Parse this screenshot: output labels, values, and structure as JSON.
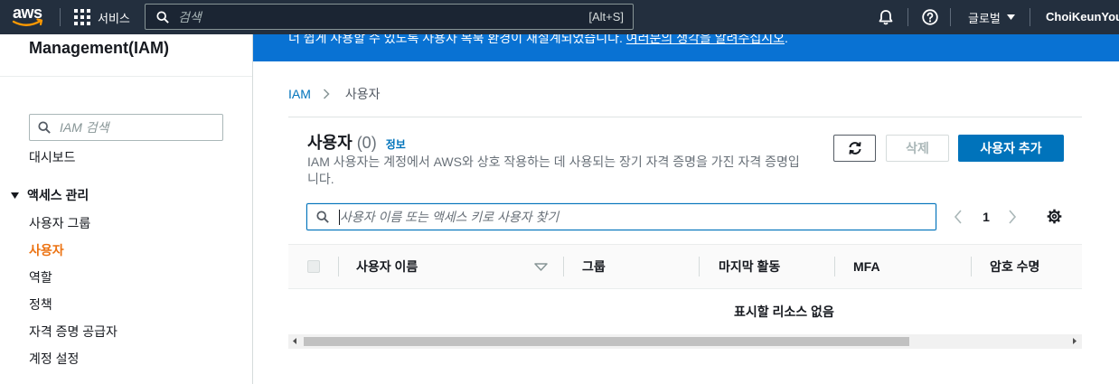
{
  "nav": {
    "logo_text": "aws",
    "services_label": "서비스",
    "search": {
      "placeholder": "검색",
      "value": "",
      "shortcut": "[Alt+S]"
    },
    "region_label": "글로벌",
    "user_label": "ChoiKeunYoung"
  },
  "sidebar": {
    "title": "Management(IAM)",
    "search": {
      "placeholder": "IAM 검색",
      "value": ""
    },
    "dashboard_label": "대시보드",
    "section": {
      "label": "액세스 관리",
      "expanded": true
    },
    "items": [
      {
        "label": "사용자 그룹",
        "active": false
      },
      {
        "label": "사용자",
        "active": true
      },
      {
        "label": "역할",
        "active": false
      },
      {
        "label": "정책",
        "active": false
      },
      {
        "label": "자격 증명 공급자",
        "active": false
      },
      {
        "label": "계정 설정",
        "active": false
      }
    ]
  },
  "banner": {
    "text": "너 쉽게 사용할 수 있도록 사용자 복북 환경이 새설계되었습니다. ",
    "link_text": "여러분의 생각을 알려주십시오",
    "suffix": "."
  },
  "breadcrumb": {
    "root": "IAM",
    "current": "사용자"
  },
  "users_panel": {
    "title": "사용자",
    "count": "(0)",
    "info_link": "정보",
    "description": "IAM 사용자는 계정에서 AWS와 상호 작용하는 데 사용되는 장기 자격 증명을 가진 자격 증명입니다.",
    "buttons": {
      "delete_label": "삭제",
      "delete_disabled": true,
      "add_label": "사용자 추가"
    },
    "search": {
      "placeholder": "사용자 이름 또는 액세스 키로 사용자 찾기",
      "value": ""
    },
    "pagination": {
      "current_page": "1",
      "prev_disabled": true,
      "next_disabled": true
    },
    "table": {
      "columns": [
        {
          "label": "사용자 이름",
          "sortable": true
        },
        {
          "label": "그룹"
        },
        {
          "label": "마지막 활동"
        },
        {
          "label": "MFA"
        },
        {
          "label": "암호 수명"
        }
      ],
      "rows": [],
      "empty_text": "표시할 리소스 없음"
    }
  },
  "icons": {
    "logo": "aws-logo",
    "services": "grid-icon",
    "search": "search-icon",
    "notifications": "bell-icon",
    "help": "help-icon",
    "region_caret": "caret-down-icon",
    "section_caret": "caret-down-icon",
    "breadcrumb_separator": "chevron-right-icon",
    "refresh": "refresh-icon",
    "pagination_prev": "chevron-left-icon",
    "pagination_next": "chevron-right-icon",
    "preferences": "settings-icon",
    "sort": "sort-descending-icon",
    "scroll_left": "scroll-left-arrow-icon",
    "scroll_right": "scroll-right-arrow-icon"
  },
  "colors": {
    "nav_background": "#232f3e",
    "banner_background": "#0972d3",
    "accent": "#0073bb",
    "active_nav": "#ec7211",
    "logo_smile": "#ff9900",
    "muted_text": "#687078"
  }
}
